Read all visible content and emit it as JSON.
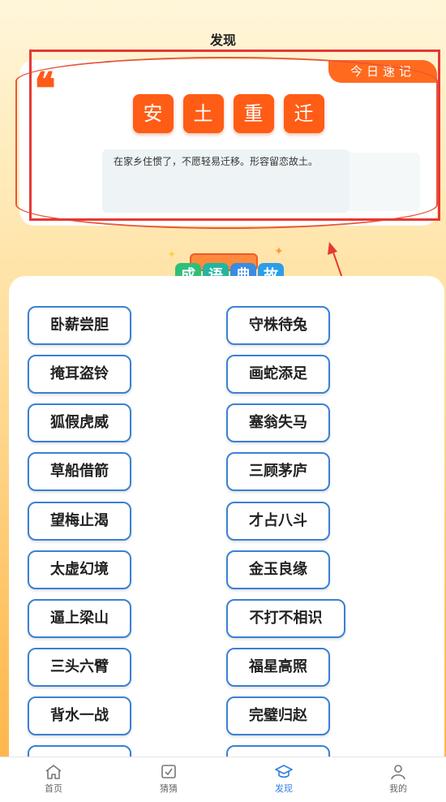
{
  "header": {
    "title": "发现"
  },
  "daily": {
    "badge": "今日速记",
    "quote_mark": "❛❛",
    "chars": [
      "安",
      "土",
      "重",
      "迁"
    ],
    "meaning": "在家乡住惯了，不愿轻易迁移。形容留恋故土。"
  },
  "banner": {
    "chars": [
      "成",
      "语",
      "典",
      "故"
    ]
  },
  "idioms": {
    "left": [
      "卧薪尝胆",
      "掩耳盗铃",
      "狐假虎威",
      "草船借箭",
      "望梅止渴",
      "太虚幻境",
      "逼上梁山",
      "三头六臂",
      "背水一战"
    ],
    "right": [
      "守株待兔",
      "画蛇添足",
      "塞翁失马",
      "三顾茅庐",
      "才占八斗",
      "金玉良缘",
      "不打不相识",
      "福星高照",
      "完璧归赵"
    ]
  },
  "tabs": [
    {
      "label": "首页",
      "icon": "home-icon"
    },
    {
      "label": "猜猜",
      "icon": "check-box-icon"
    },
    {
      "label": "发现",
      "icon": "graduation-cap-icon"
    },
    {
      "label": "我的",
      "icon": "user-icon"
    }
  ],
  "colors": {
    "accent": "#ff5c15",
    "border_blue": "#3b80d6",
    "active_tab": "#2f7fe0",
    "annotation": "#e53935"
  }
}
